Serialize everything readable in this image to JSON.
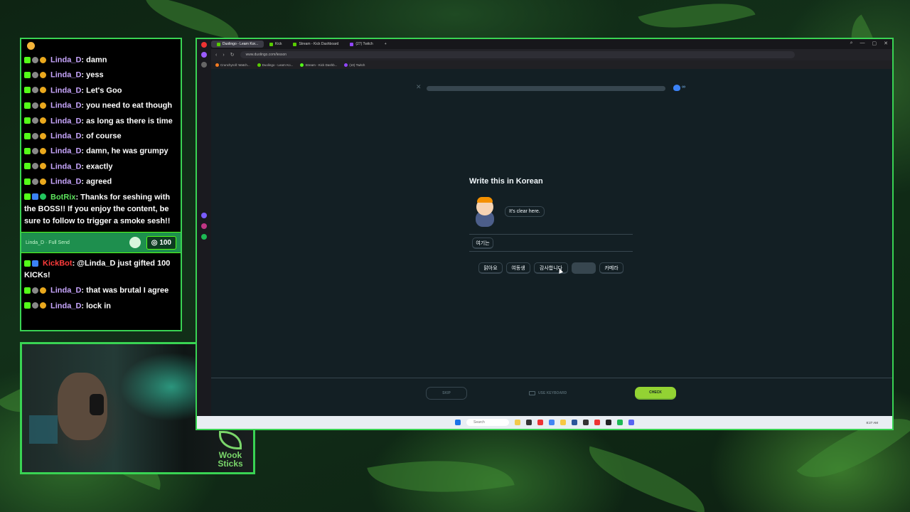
{
  "chat": {
    "messages": [
      {
        "user": "Linda_D",
        "text": ": damn",
        "style": "linda",
        "badges": [
          "kick",
          "gray",
          "gold"
        ]
      },
      {
        "user": "Linda_D",
        "text": ": yess",
        "style": "linda",
        "badges": [
          "kick",
          "gray",
          "gold"
        ]
      },
      {
        "user": "Linda_D",
        "text": ": Let's Goo",
        "style": "linda",
        "badges": [
          "kick",
          "gray",
          "gold"
        ]
      },
      {
        "user": "Linda_D",
        "text": ": you need to eat though",
        "style": "linda",
        "badges": [
          "kick",
          "gray",
          "gold"
        ]
      },
      {
        "user": "Linda_D",
        "text": ": as long as there is time",
        "style": "linda",
        "badges": [
          "kick",
          "gray",
          "gold"
        ]
      },
      {
        "user": "Linda_D",
        "text": ": of course",
        "style": "linda",
        "badges": [
          "kick",
          "gray",
          "gold"
        ]
      },
      {
        "user": "Linda_D",
        "text": ": damn, he was grumpy",
        "style": "linda",
        "badges": [
          "kick",
          "gray",
          "gold"
        ]
      },
      {
        "user": "Linda_D",
        "text": ": exactly",
        "style": "linda",
        "badges": [
          "kick",
          "gray",
          "gold"
        ]
      },
      {
        "user": "Linda_D",
        "text": ": agreed",
        "style": "linda",
        "badges": [
          "kick",
          "gray",
          "gold"
        ]
      },
      {
        "user": "BotRix",
        "text": ": Thanks for seshing with the BOSS!! If you enjoy the content, be sure to follow to trigger a smoke sesh!!",
        "style": "botrix",
        "badges": [
          "kick",
          "blue",
          "green"
        ]
      }
    ],
    "sub_banner": {
      "label": "Linda_D · Full Send",
      "amount": "100"
    },
    "messages_after": [
      {
        "user": "KickBot",
        "text": ": @Linda_D just gifted 100 KICKs!",
        "style": "kickbot",
        "badges": [
          "kick",
          "blue"
        ]
      },
      {
        "user": "Linda_D",
        "text": ": that was brutal I agree",
        "style": "linda",
        "badges": [
          "kick",
          "gray",
          "gold"
        ]
      },
      {
        "user": "Linda_D",
        "text": ": lock in",
        "style": "linda",
        "badges": [
          "kick",
          "gray",
          "gold"
        ]
      }
    ]
  },
  "webcam": {
    "logo_line1": "Wook",
    "logo_line2": "Sticks"
  },
  "browser": {
    "tabs": [
      "Duolingo - Learn Kor...",
      "Kick",
      "Stream - Kick Dashboard",
      "(27) Twitch"
    ],
    "url": "www.duolingo.com/lesson",
    "bookmarks": [
      "Crunchyroll: Watch...",
      "Duolingo - Learn Ko...",
      "Stream - Kick Dashb...",
      "(10) Twitch"
    ]
  },
  "lesson": {
    "close": "✕",
    "hearts": "∞",
    "title": "Write this in Korean",
    "speech": "It's clear here.",
    "answer_chips": [
      "여기는"
    ],
    "word_bank": [
      "맑아요",
      "여동생",
      "감사합니다",
      "",
      "카메라"
    ],
    "skip": "SKIP",
    "keyboard": "USE KEYBOARD",
    "check": "CHECK"
  },
  "taskbar": {
    "search": "Search",
    "time": "8:27 AM"
  },
  "colors": {
    "accent": "#39d353",
    "duo_bg": "#131f24",
    "check": "#93d333"
  }
}
